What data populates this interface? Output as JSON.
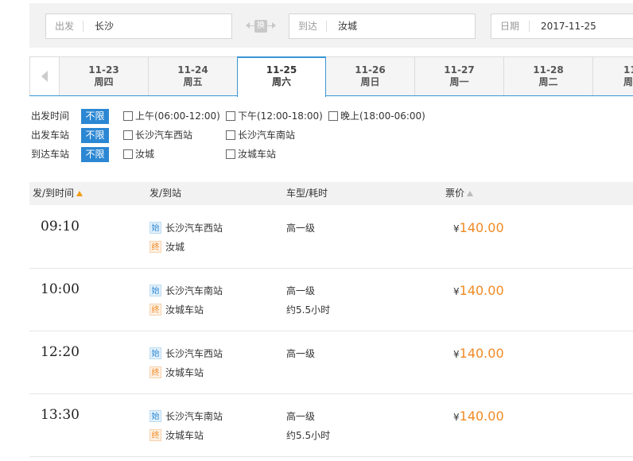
{
  "search": {
    "from_label": "出发",
    "from_value": "长沙",
    "swap_label": "换",
    "to_label": "到达",
    "to_value": "汝城",
    "date_label": "日期",
    "date_value": "2017-11-25"
  },
  "date_tabs": [
    {
      "date": "11-23",
      "weekday": "周四"
    },
    {
      "date": "11-24",
      "weekday": "周五"
    },
    {
      "date": "11-25",
      "weekday": "周六",
      "active": true
    },
    {
      "date": "11-26",
      "weekday": "周日"
    },
    {
      "date": "11-27",
      "weekday": "周一"
    },
    {
      "date": "11-28",
      "weekday": "周二"
    },
    {
      "date": "11",
      "weekday": "周"
    }
  ],
  "filters": {
    "no_limit": "不限",
    "time": {
      "label": "出发时间",
      "options": [
        "上午(06:00-12:00)",
        "下午(12:00-18:00)",
        "晚上(18:00-06:00)"
      ]
    },
    "depart_station": {
      "label": "出发车站",
      "options": [
        "长沙汽车西站",
        "长沙汽车南站"
      ]
    },
    "arrive_station": {
      "label": "到达车站",
      "options": [
        "汝城",
        "汝城车站"
      ]
    }
  },
  "table": {
    "headers": {
      "time": "发/到时间",
      "station": "发/到站",
      "type": "车型/耗时",
      "price": "票价"
    },
    "start_badge": "始",
    "end_badge": "终",
    "currency": "¥",
    "rows": [
      {
        "time": "09:10",
        "from": "长沙汽车西站",
        "to": "汝城",
        "bus": "高一级",
        "duration": "",
        "price": "140.00"
      },
      {
        "time": "10:00",
        "from": "长沙汽车南站",
        "to": "汝城车站",
        "bus": "高一级",
        "duration": "约5.5小时",
        "price": "140.00"
      },
      {
        "time": "12:20",
        "from": "长沙汽车西站",
        "to": "汝城车站",
        "bus": "高一级",
        "duration": "",
        "price": "140.00"
      },
      {
        "time": "13:30",
        "from": "长沙汽车南站",
        "to": "汝城车站",
        "bus": "高一级",
        "duration": "约5.5小时",
        "price": "140.00"
      }
    ]
  },
  "colors": {
    "accent": "#2b87d3",
    "price": "#f08a24",
    "tab_border": "#3a96d6"
  }
}
